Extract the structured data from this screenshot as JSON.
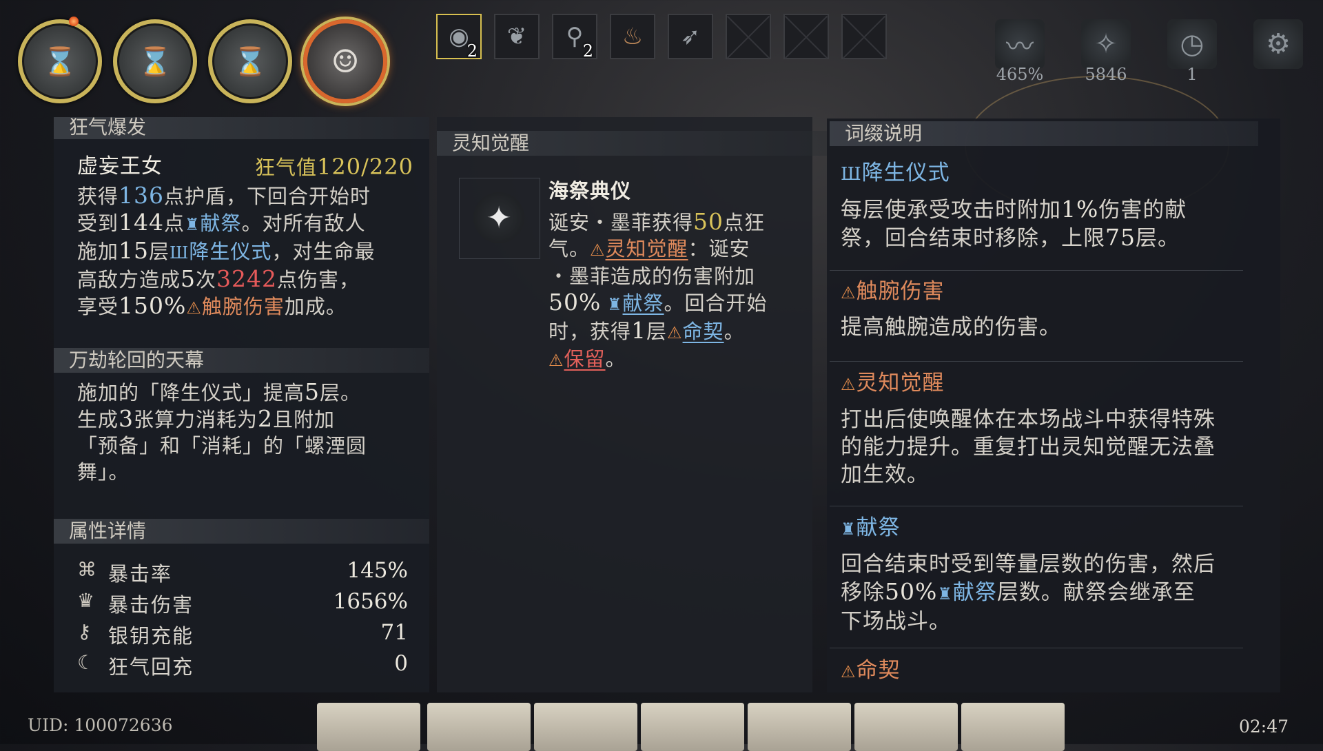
{
  "portraits": [
    {
      "name": "hourglass-portrait-1",
      "icon": "hourglass-icon"
    },
    {
      "name": "hourglass-portrait-2",
      "icon": "hourglass-icon"
    },
    {
      "name": "hourglass-portrait-3",
      "icon": "hourglass-icon"
    },
    {
      "name": "character-portrait-active",
      "icon": "character-face-icon"
    }
  ],
  "items": [
    {
      "icon": "orb-relic-icon",
      "count": "2",
      "selected": true
    },
    {
      "icon": "wings-relic-icon",
      "count": ""
    },
    {
      "icon": "telescope-relic-icon",
      "count": "2"
    },
    {
      "icon": "flame-bottle-relic-icon",
      "count": ""
    },
    {
      "icon": "feather-relic-icon",
      "count": ""
    },
    {
      "icon": "empty-slot",
      "count": ""
    },
    {
      "icon": "empty-slot",
      "count": ""
    },
    {
      "icon": "empty-slot",
      "count": ""
    }
  ],
  "stats": {
    "pulse_value": "465%",
    "shard_value": "5846",
    "clock_value": "1"
  },
  "left_panel": {
    "section1_title": "狂气爆发",
    "card_name": "虚妄王女",
    "madness_label": "狂气值",
    "madness_value": "120/220",
    "desc": {
      "a1": "获得",
      "n1": "136",
      "a2": "点护盾，下回合开始时",
      "a3": "受到",
      "n2": "144",
      "a4": "点",
      "kw1": "献祭",
      "a5": "。对所有敌人",
      "a6": "施加",
      "n3": "15",
      "a7": "层",
      "kw2": "降生仪式",
      "a8": "，对生命最",
      "a9": "高敌方造成",
      "n4": "5",
      "a10": "次",
      "n5": "3242",
      "a11": "点伤害，",
      "a12": "享受",
      "n6": "150%",
      "kw3": "触腕伤害",
      "a13": "加成。"
    },
    "section2_title": "万劫轮回的天幕",
    "section2_lines": [
      "施加的「降生仪式」提高",
      "5",
      "层。",
      "生成",
      "3",
      "张算力消耗为",
      "2",
      "且附加",
      "「预备」和「消耗」的「螺湮圆",
      "舞」。"
    ],
    "section3_title": "属性详情",
    "attributes": [
      {
        "icon": "crit-rate-icon",
        "label": "暴击率",
        "value": "145%"
      },
      {
        "icon": "crit-damage-icon",
        "label": "暴击伤害",
        "value": "1656%"
      },
      {
        "icon": "silver-key-icon",
        "label": "银钥充能",
        "value": "71"
      },
      {
        "icon": "madness-regen-icon",
        "label": "狂气回充",
        "value": "0"
      }
    ]
  },
  "mid_panel": {
    "title": "灵知觉醒",
    "skill_name": "海祭典仪",
    "p1": "诞安・墨菲获得",
    "n1": "50",
    "p2": "点狂",
    "p3": "气。",
    "kw1": "灵知觉醒",
    "p4": "：诞安",
    "p5": "・墨菲造成的伤害附加",
    "n2": "50%",
    "kw2": "献祭",
    "p6": "。回合开始",
    "p7": "时，获得",
    "n3": "1",
    "p8": "层",
    "kw3": "命契",
    "p9": "。",
    "kw4": "保留",
    "p10": "。"
  },
  "right_panel": {
    "title": "词缀说明",
    "entries": [
      {
        "name": "降生仪式",
        "lines": [
          "每层使承受攻击时附加",
          "1%",
          "伤害的献",
          "祭，回合结束时移除，上限",
          "75",
          "层。"
        ]
      },
      {
        "name": "触腕伤害",
        "text": "提高触腕造成的伤害。"
      },
      {
        "name": "灵知觉醒",
        "text1": "打出后使唤醒体在本场战斗中获得特殊",
        "text2": "的能力提升。重复打出灵知觉醒无法叠",
        "text3": "加生效。"
      },
      {
        "name": "献祭",
        "l1a": "回合结束时受到等量层数的伤害，然后",
        "l2a": "移除",
        "l2n": "50%",
        "l2kw": "献祭",
        "l2b": "层数。献祭会继承至",
        "l3": "下场战斗。"
      },
      {
        "name": "命契"
      }
    ]
  },
  "footer": {
    "uid": "UID: 100072636",
    "time": "02:47"
  },
  "colors": {
    "accent_gold": "#c9b45a",
    "keyword_blue": "#7eb6e4",
    "keyword_orange": "#e08a5c",
    "damage_red": "#e65a5a"
  }
}
